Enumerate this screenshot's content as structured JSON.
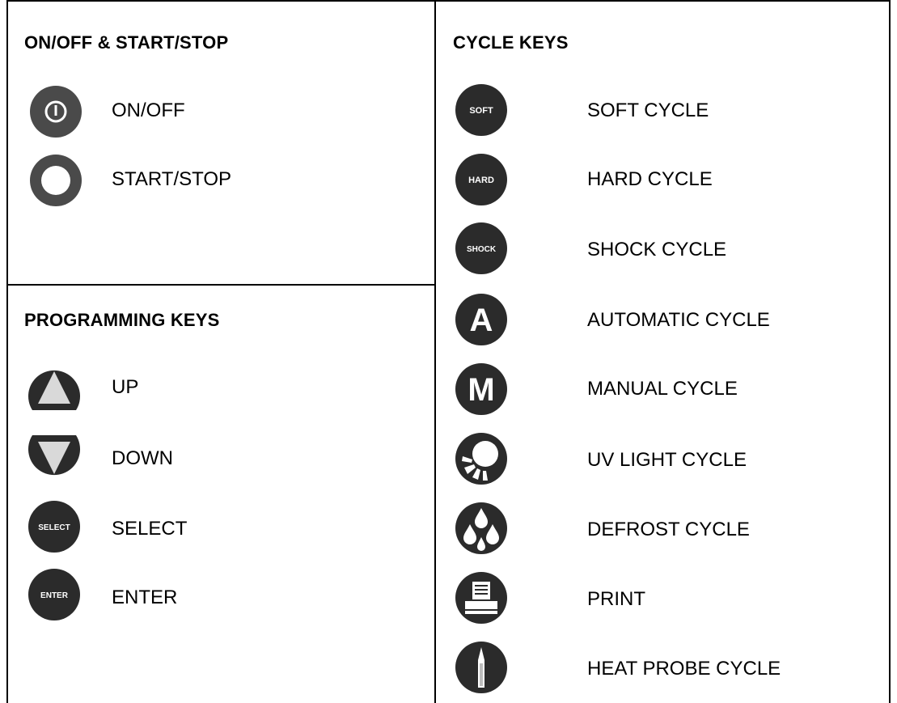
{
  "sections": {
    "power": {
      "heading": "ON/OFF & START/STOP",
      "items": [
        {
          "icon": "power-icon",
          "label": "ON/OFF"
        },
        {
          "icon": "start-stop-icon",
          "label": "START/STOP"
        }
      ]
    },
    "programming": {
      "heading": "PROGRAMMING KEYS",
      "items": [
        {
          "icon": "up-arrow-icon",
          "label": "UP"
        },
        {
          "icon": "down-arrow-icon",
          "label": "DOWN"
        },
        {
          "icon": "select-icon",
          "label": "SELECT",
          "icon_text": "SELECT"
        },
        {
          "icon": "enter-icon",
          "label": "ENTER",
          "icon_text": "ENTER"
        }
      ]
    },
    "cycle": {
      "heading": "CYCLE KEYS",
      "items": [
        {
          "icon": "soft-icon",
          "label": "SOFT CYCLE",
          "icon_text": "SOFT"
        },
        {
          "icon": "hard-icon",
          "label": "HARD CYCLE",
          "icon_text": "HARD"
        },
        {
          "icon": "shock-icon",
          "label": "SHOCK CYCLE",
          "icon_text": "SHOCK"
        },
        {
          "icon": "automatic-icon",
          "label": "AUTOMATIC CYCLE",
          "icon_text": "A"
        },
        {
          "icon": "manual-icon",
          "label": "MANUAL CYCLE",
          "icon_text": "M"
        },
        {
          "icon": "uv-light-icon",
          "label": "UV LIGHT CYCLE"
        },
        {
          "icon": "defrost-icon",
          "label": "DEFROST CYCLE"
        },
        {
          "icon": "print-icon",
          "label": "PRINT"
        },
        {
          "icon": "heat-probe-icon",
          "label": "HEAT PROBE CYCLE"
        }
      ]
    }
  },
  "colors": {
    "key_dark": "#2b2b2b",
    "key_grey": "#4a4a4a",
    "symbol_light": "#d9d9d9"
  }
}
